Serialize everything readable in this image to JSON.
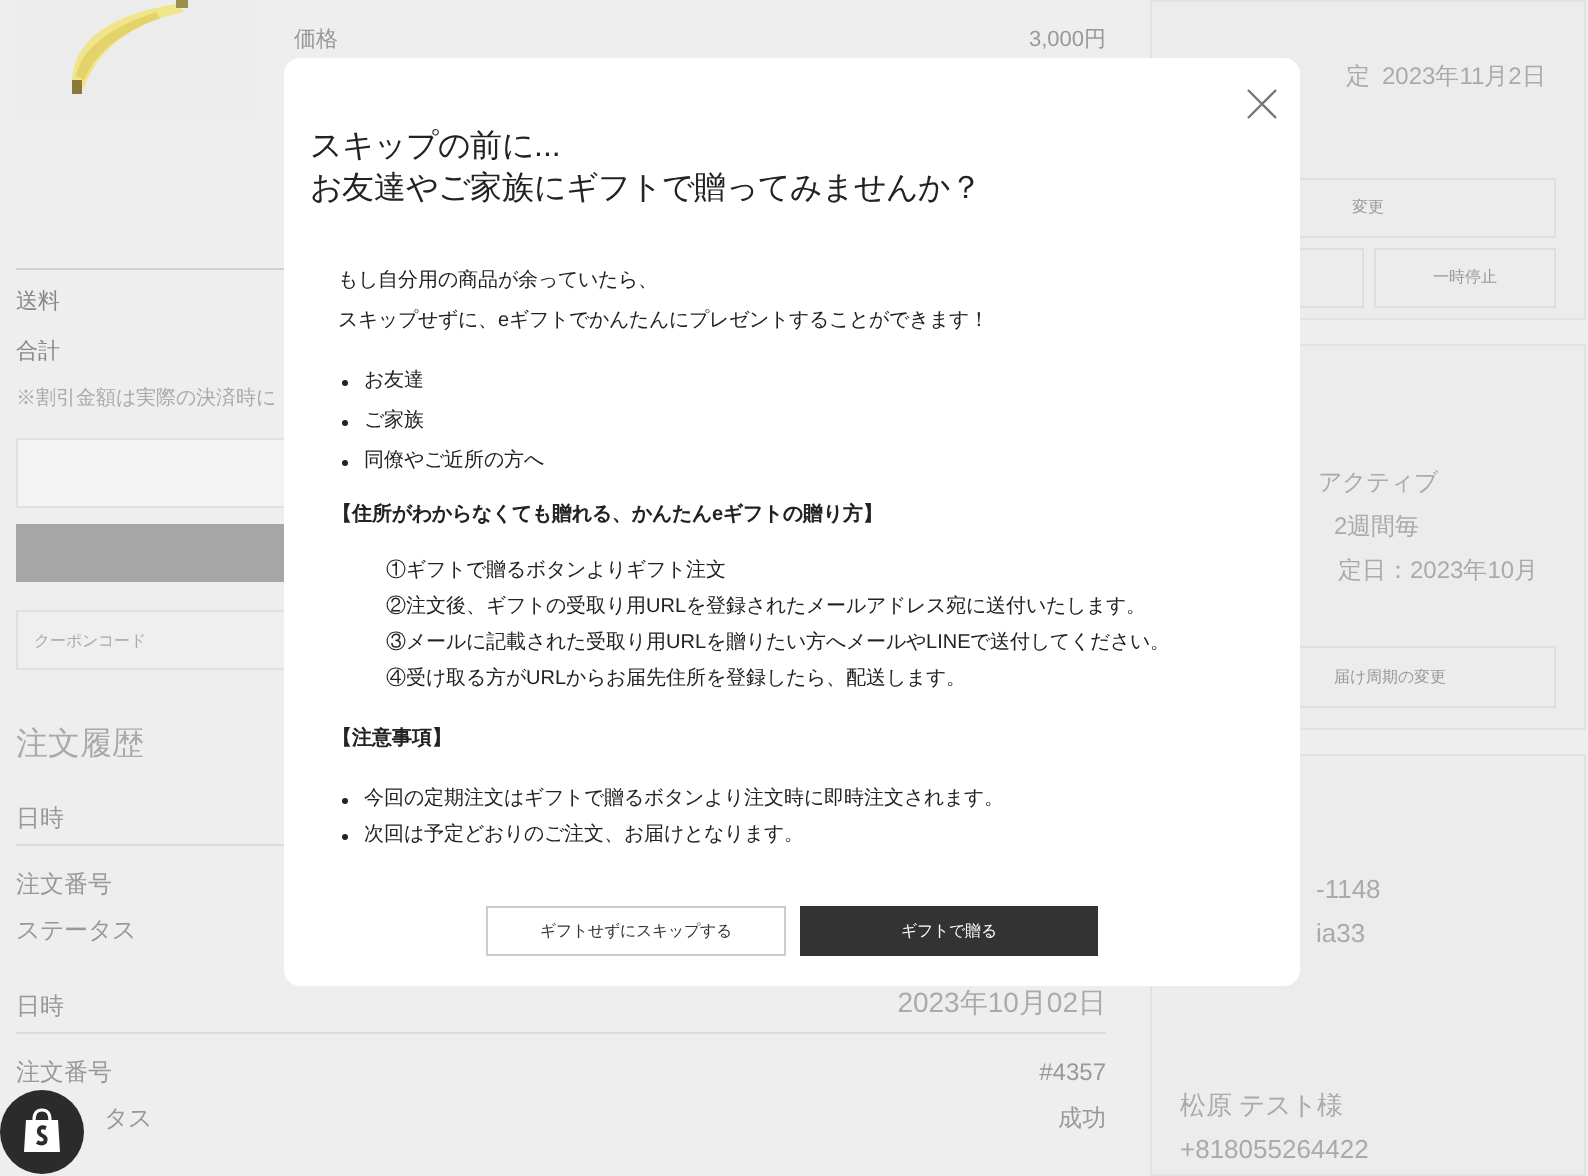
{
  "product": {
    "label": "価格",
    "price": "3,000円"
  },
  "summary": [
    {
      "label": "送料"
    },
    {
      "label": "合計"
    }
  ],
  "note": "※割引金額は実際の決済時に",
  "coupon": {
    "placeholder": "クーポンコード"
  },
  "order_history": {
    "title": "注文履歴",
    "rows": [
      {
        "kind": "date",
        "label": "日時"
      },
      {
        "kind": "field",
        "label": "注文番号"
      },
      {
        "kind": "field",
        "label": "ステータス"
      },
      {
        "kind": "date",
        "label": "日時",
        "value": "2023年10月02日"
      },
      {
        "kind": "field",
        "label": "注文番号",
        "value": "#4357"
      },
      {
        "kind": "field",
        "label": "タス",
        "value": "成功"
      }
    ]
  },
  "subscription": {
    "next_label": "定",
    "next_date": "2023年11月2日",
    "change_button": "変更",
    "pause_button": "一時停止"
  },
  "plan": {
    "status": "アクティブ",
    "interval": "2週間毎",
    "next": "定日：2023年10月",
    "button": "届け周期の変更"
  },
  "address": {
    "lines": [
      "-1148",
      "ia33"
    ],
    "name": "松原 テスト様",
    "phone": "+818055264422"
  },
  "modal": {
    "title_lines": [
      "スキップの前に...",
      "お友達やご家族にギフトで贈ってみませんか？"
    ],
    "intro": [
      "もし自分用の商品が余っていたら、",
      "スキップせずに、eギフトでかんたんにプレゼントすることができます！"
    ],
    "recipients": [
      "お友達",
      "ご家族",
      "同僚やご近所の方へ"
    ],
    "howto_heading": "【住所がわからなくても贈れる、かんたんeギフトの贈り方】",
    "steps": [
      "①ギフトで贈るボタンよりギフト注文",
      "②注文後、ギフトの受取り用URLを登録されたメールアドレス宛に送付いたします。",
      "③メールに記載された受取り用URLを贈りたい方へメールやLINEで送付してください。",
      "④受け取る方がURLからお届先住所を登録したら、配送します。"
    ],
    "notes_heading": "【注意事項】",
    "notes": [
      "今回の定期注文はギフトで贈るボタンより注文時に即時注文されます。",
      "次回は予定どおりのご注文、お届けとなります。"
    ],
    "buttons": [
      {
        "label": "ギフトせずにスキップする",
        "kind": "secondary"
      },
      {
        "label": "ギフトで贈る",
        "kind": "primary"
      }
    ]
  }
}
